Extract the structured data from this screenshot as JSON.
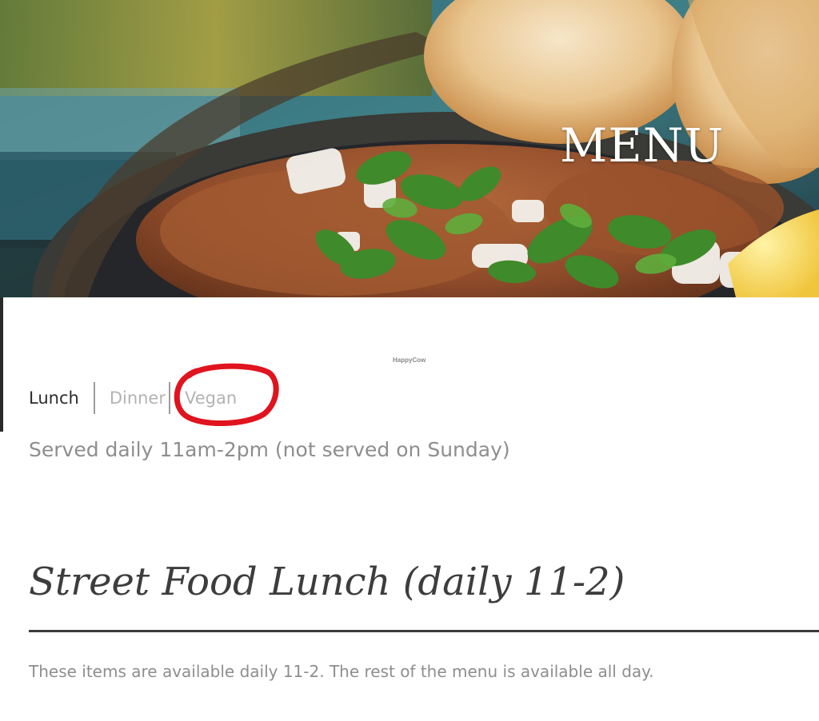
{
  "hero": {
    "title": "MENU",
    "image_icon": "food-photo"
  },
  "watermark": "HappyCow",
  "tabs": [
    {
      "label": "Lunch",
      "active": true
    },
    {
      "label": "Dinner",
      "active": false
    },
    {
      "label": "Vegan",
      "active": false,
      "annotated": true
    }
  ],
  "annotation_color": "#e0141e",
  "served_text": "Served daily 11am-2pm (not served on Sunday)",
  "section": {
    "title": "Street Food Lunch (daily 11-2)",
    "description": "These items are available daily 11-2. The rest of the menu is available all day."
  }
}
